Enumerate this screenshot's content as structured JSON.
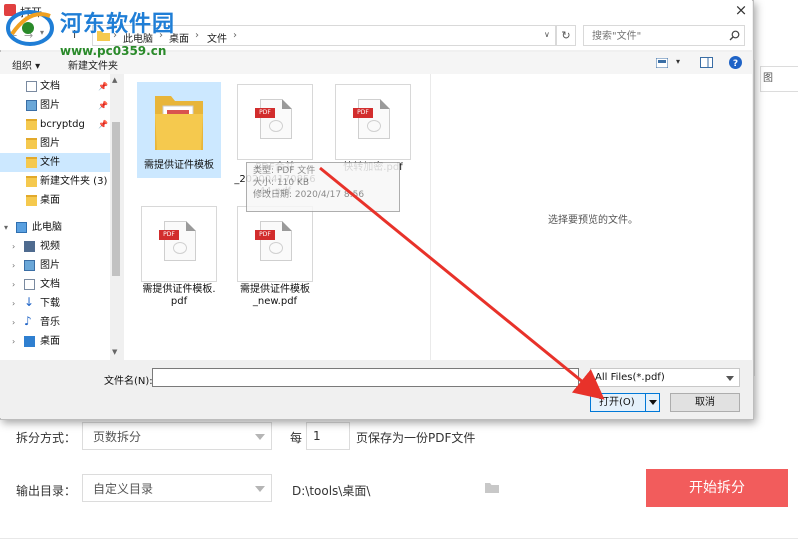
{
  "watermark": {
    "site_name": "河东软件园",
    "url": "www.pc0359.cn"
  },
  "dialog": {
    "title": "打开",
    "close_glyph": "×",
    "breadcrumb": [
      "此电脑",
      "桌面",
      "文件"
    ],
    "breadcrumb_sep": "›",
    "refresh_glyph": "↻",
    "search_placeholder": "搜索\"文件\"",
    "toolbar": {
      "organize": "组织 ▾",
      "new_folder": "新建文件夹"
    },
    "nav": {
      "quick_access": [
        {
          "label": "文档",
          "icon": "document-icon",
          "pinned": true
        },
        {
          "label": "图片",
          "icon": "picture-icon",
          "pinned": true
        },
        {
          "label": "bcryptdg",
          "icon": "folder-icon",
          "pinned": true
        },
        {
          "label": "图片",
          "icon": "folder-icon",
          "pinned": false
        },
        {
          "label": "文件",
          "icon": "folder-icon",
          "pinned": false,
          "selected": true
        },
        {
          "label": "新建文件夹 (3)",
          "icon": "folder-icon",
          "pinned": false
        },
        {
          "label": "桌面",
          "icon": "folder-icon",
          "pinned": false
        }
      ],
      "this_pc": "此电脑",
      "this_pc_items": [
        {
          "label": "视频",
          "icon": "video-icon"
        },
        {
          "label": "图片",
          "icon": "picture-icon"
        },
        {
          "label": "文档",
          "icon": "document-icon"
        },
        {
          "label": "下载",
          "icon": "download-icon"
        },
        {
          "label": "音乐",
          "icon": "music-icon"
        },
        {
          "label": "桌面",
          "icon": "desktop-icon"
        }
      ]
    },
    "files": [
      {
        "name": "需提供证件模板",
        "type": "folder",
        "selected": true
      },
      {
        "name": "PDF合并_20200417085644.pdf",
        "name_lines": [
          "PDF合并",
          "_202004170856",
          "44.pdf"
        ],
        "type": "pdf"
      },
      {
        "name": "快转加密.pdf",
        "type": "pdf"
      },
      {
        "name": "需提供证件模板.pdf",
        "name_lines": [
          "需提供证件模板.",
          "pdf"
        ],
        "type": "pdf"
      },
      {
        "name": "需提供证件模板_new.pdf",
        "name_lines": [
          "需提供证件模板",
          "_new.pdf"
        ],
        "type": "pdf"
      }
    ],
    "tooltip": {
      "line1": "类型: PDF 文件",
      "line2": "大小: 110 KB",
      "line3": "修改日期: 2020/4/17 8:56"
    },
    "preview_hint": "选择要预览的文件。",
    "filename_label": "文件名(N):",
    "filename_value": "",
    "file_type": "All Files(*.pdf)",
    "open_label": "打开(O)",
    "cancel_label": "取消"
  },
  "background": {
    "right_stub": "图",
    "split_mode_label": "拆分方式：",
    "split_mode_value": "页数拆分",
    "every_label": "每",
    "every_value": "1",
    "every_suffix": "页保存为一份PDF文件",
    "output_label": "输出目录：",
    "output_mode": "自定义目录",
    "output_path": "D:\\tools\\桌面\\",
    "start_button": "开始拆分"
  },
  "colors": {
    "accent": "#f25c5c",
    "selection": "#cce8ff",
    "arrow": "#e8322a",
    "watermark_blue": "#1f7ed6"
  }
}
